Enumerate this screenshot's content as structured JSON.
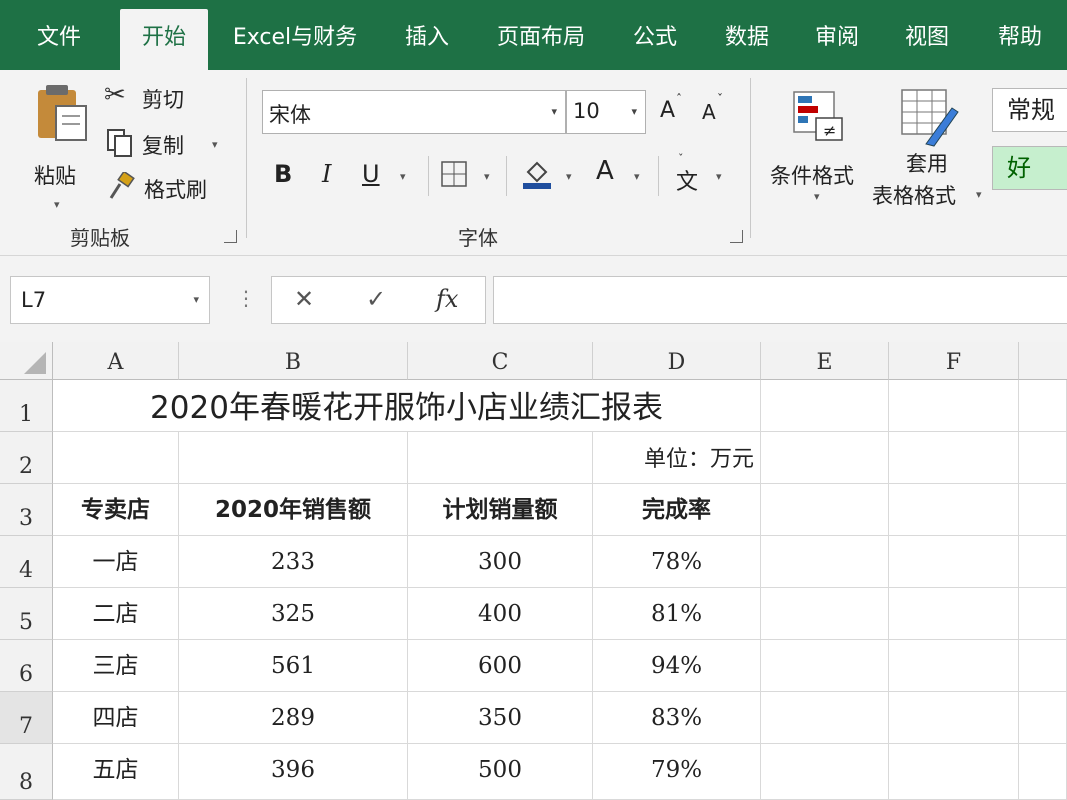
{
  "ribbon_tabs": [
    "文件",
    "开始",
    "Excel与财务",
    "插入",
    "页面布局",
    "公式",
    "数据",
    "审阅",
    "视图",
    "帮助"
  ],
  "active_tab": "开始",
  "clipboard": {
    "paste_label": "粘贴",
    "cut_label": "剪切",
    "copy_label": "复制",
    "format_painter_label": "格式刷",
    "group_label": "剪贴板"
  },
  "font": {
    "font_name": "宋体",
    "font_size": "10",
    "increase_label": "A",
    "decrease_label": "A",
    "bold_label": "B",
    "italic_label": "I",
    "underline_label": "U",
    "font_color_label": "A",
    "phonetic_label": "文",
    "group_label": "字体"
  },
  "styles": {
    "conditional_format_label": "条件格式",
    "table_format_line1": "套用",
    "table_format_line2": "表格格式",
    "normal_style": "常规",
    "good_style": "好"
  },
  "formula_bar": {
    "name_box": "L7",
    "cancel_symbol": "✕",
    "enter_symbol": "✓",
    "fx_label": "fx",
    "value": ""
  },
  "grid": {
    "columns": [
      "A",
      "B",
      "C",
      "D",
      "E",
      "F"
    ],
    "rows": [
      "1",
      "2",
      "3",
      "4",
      "5",
      "6",
      "7",
      "8"
    ],
    "title": "2020年春暖花开服饰小店业绩汇报表",
    "unit": "单位：万元",
    "headers": [
      "专卖店",
      "2020年销售额",
      "计划销量额",
      "完成率"
    ],
    "data": [
      [
        "一店",
        "233",
        "300",
        "78%"
      ],
      [
        "二店",
        "325",
        "400",
        "81%"
      ],
      [
        "三店",
        "561",
        "600",
        "94%"
      ],
      [
        "四店",
        "289",
        "350",
        "83%"
      ],
      [
        "五店",
        "396",
        "500",
        "79%"
      ]
    ]
  },
  "colors": {
    "ribbon_green": "#1e7145",
    "good_style_fill": "#c6efce",
    "good_style_text": "#006100"
  }
}
